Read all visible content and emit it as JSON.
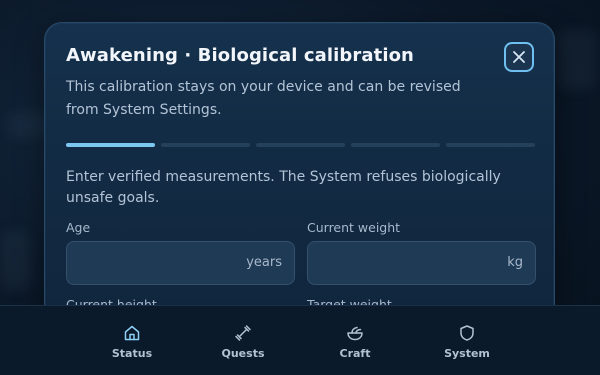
{
  "dialog": {
    "title": "Awakening · Biological calibration",
    "subtitle": "This calibration stays on your device and can be revised from System Settings.",
    "close_icon": "close-icon",
    "progress": {
      "total_steps": 5,
      "current_step": 1
    },
    "intro": "Enter verified measurements. The System refuses biologically unsafe goals.",
    "fields": {
      "age": {
        "label": "Age",
        "unit": "years",
        "value": ""
      },
      "current_weight": {
        "label": "Current weight",
        "unit": "kg",
        "value": ""
      },
      "current_height": {
        "label": "Current height"
      },
      "target_weight": {
        "label": "Target weight"
      }
    }
  },
  "tabbar": {
    "tabs": [
      {
        "id": "status",
        "label": "Status",
        "icon": "home-icon",
        "active": true
      },
      {
        "id": "quests",
        "label": "Quests",
        "icon": "dumbbell-icon",
        "active": false
      },
      {
        "id": "craft",
        "label": "Craft",
        "icon": "bowl-icon",
        "active": false
      },
      {
        "id": "system",
        "label": "System",
        "icon": "shield-icon",
        "active": false
      }
    ]
  },
  "colors": {
    "accent": "#7cc6f2",
    "active_tab_bg": "#17426a",
    "dialog_bg": "#15314d"
  }
}
